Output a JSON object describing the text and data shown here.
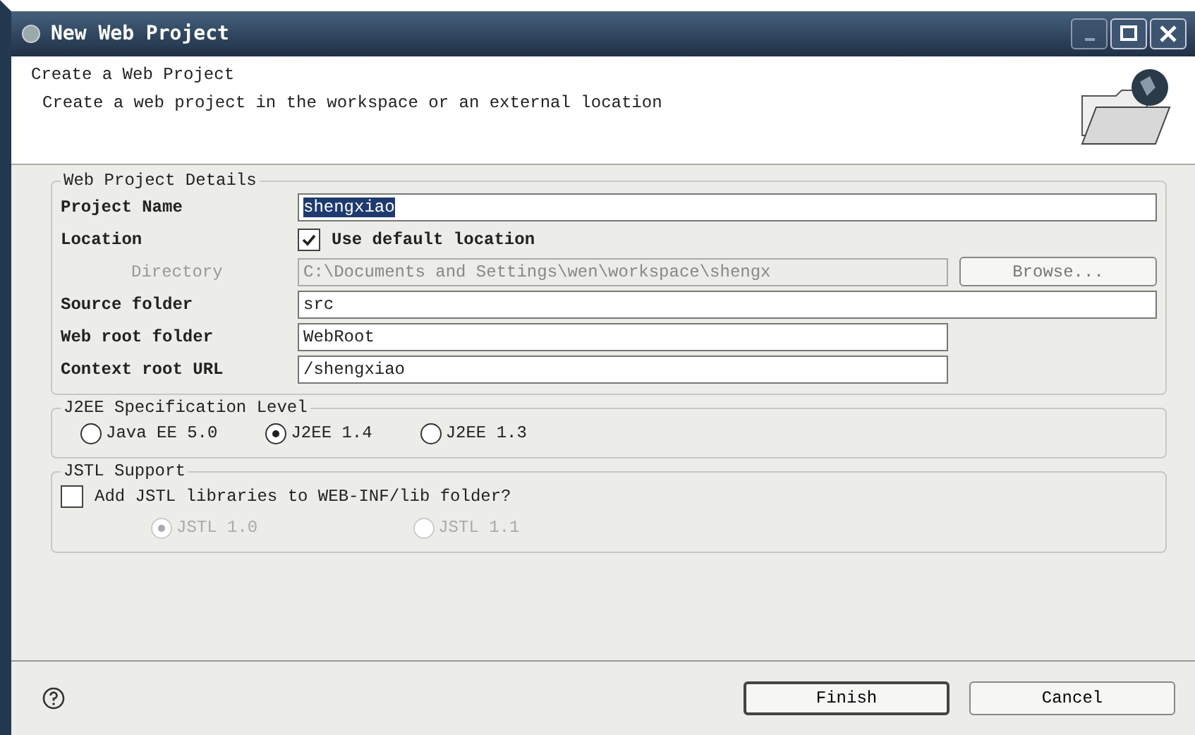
{
  "window": {
    "title": "New Web Project"
  },
  "header": {
    "title": "Create a Web Project",
    "description": "Create a web project in the workspace or an external location"
  },
  "details": {
    "legend": "Web Project Details",
    "rows": [
      {
        "kind": "text",
        "label": "Project Name",
        "value": "shengxiao",
        "highlighted": true
      },
      {
        "kind": "checkbox",
        "label": "Location",
        "option": "Use default location",
        "checked": true
      },
      {
        "kind": "browse",
        "label": "Directory",
        "value": "C:\\Documents and Settings\\wen\\workspace\\shengx",
        "disabled": true,
        "button": "Browse..."
      },
      {
        "kind": "text",
        "label": "Source folder",
        "value": "src",
        "highlighted": false
      },
      {
        "kind": "text-short",
        "label": "Web root folder",
        "value": "WebRoot",
        "highlighted": false
      },
      {
        "kind": "text-short",
        "label": "Context root URL",
        "value": "/shengxiao",
        "highlighted": false
      }
    ]
  },
  "j2ee": {
    "legend": "J2EE Specification Level",
    "options": [
      {
        "label": "Java EE 5.0",
        "selected": false
      },
      {
        "label": "J2EE 1.4",
        "selected": true
      },
      {
        "label": "J2EE 1.3",
        "selected": false
      }
    ]
  },
  "jstl": {
    "legend": "JSTL Support",
    "checkbox": {
      "label": "Add JSTL libraries to WEB-INF/lib folder?",
      "checked": false
    },
    "options": [
      {
        "label": "JSTL 1.0",
        "selected": true,
        "disabled": true
      },
      {
        "label": "JSTL 1.1",
        "selected": false,
        "disabled": true
      }
    ]
  },
  "footer": {
    "buttons": [
      {
        "label": "Finish",
        "default": true
      },
      {
        "label": "Cancel",
        "default": false
      }
    ]
  }
}
